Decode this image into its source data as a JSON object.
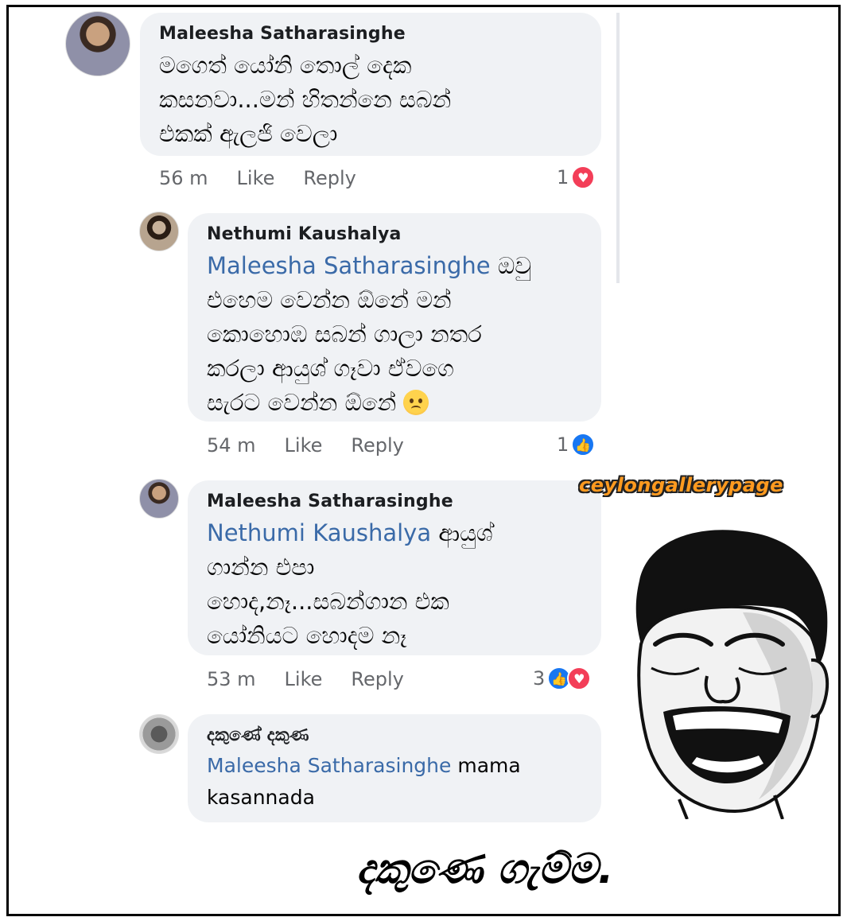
{
  "comments": [
    {
      "author": "Maleesha Satharasinghe",
      "mention": "",
      "lines": [
        "මගෙත් යෝනි තොල් දෙක",
        "කසනවා...මන් හිතන්නෙ සබන්",
        "එකක් ඇලජි වෙලා"
      ],
      "time": "56 m",
      "like": "Like",
      "reply": "Reply",
      "reaction_count": "1",
      "reactions": [
        "love-icon"
      ]
    },
    {
      "author": "Nethumi Kaushalya",
      "mention": "Maleesha Satharasinghe",
      "lines": [
        "ඔවු",
        "එහෙම වෙන්න ඕනේ මන්",
        "කොහොඹ සබන් ගාලා නතර",
        "කරලා ආයුශ් ගෑවා ඒවගෙ",
        "සැරට වෙන්න ඕනේ"
      ],
      "time": "54 m",
      "like": "Like",
      "reply": "Reply",
      "reaction_count": "1",
      "reactions": [
        "like-icon"
      ]
    },
    {
      "author": "Maleesha Satharasinghe",
      "mention": "Nethumi Kaushalya",
      "lines": [
        "ආයුශ්",
        "ගාන්න එපා",
        "හොද,නෑ...සබන්ගාන එක",
        "යෝනියට හොදම නෑ"
      ],
      "time": "53 m",
      "like": "Like",
      "reply": "Reply",
      "reaction_count": "3",
      "reactions": [
        "like-icon",
        "love-icon"
      ]
    },
    {
      "author": "දකුණේ දකුණ",
      "mention": "Maleesha Satharasinghe",
      "lines": [
        "mama",
        "kasannada"
      ]
    }
  ],
  "watermark": "ceylongallerypage",
  "caption": "දකුණෙ ගැම්ම.",
  "colors": {
    "bubble": "#f0f2f5",
    "mention": "#3a6aa8",
    "love": "#f33e58",
    "like": "#1877f2",
    "watermark": "#ff9a1f"
  }
}
